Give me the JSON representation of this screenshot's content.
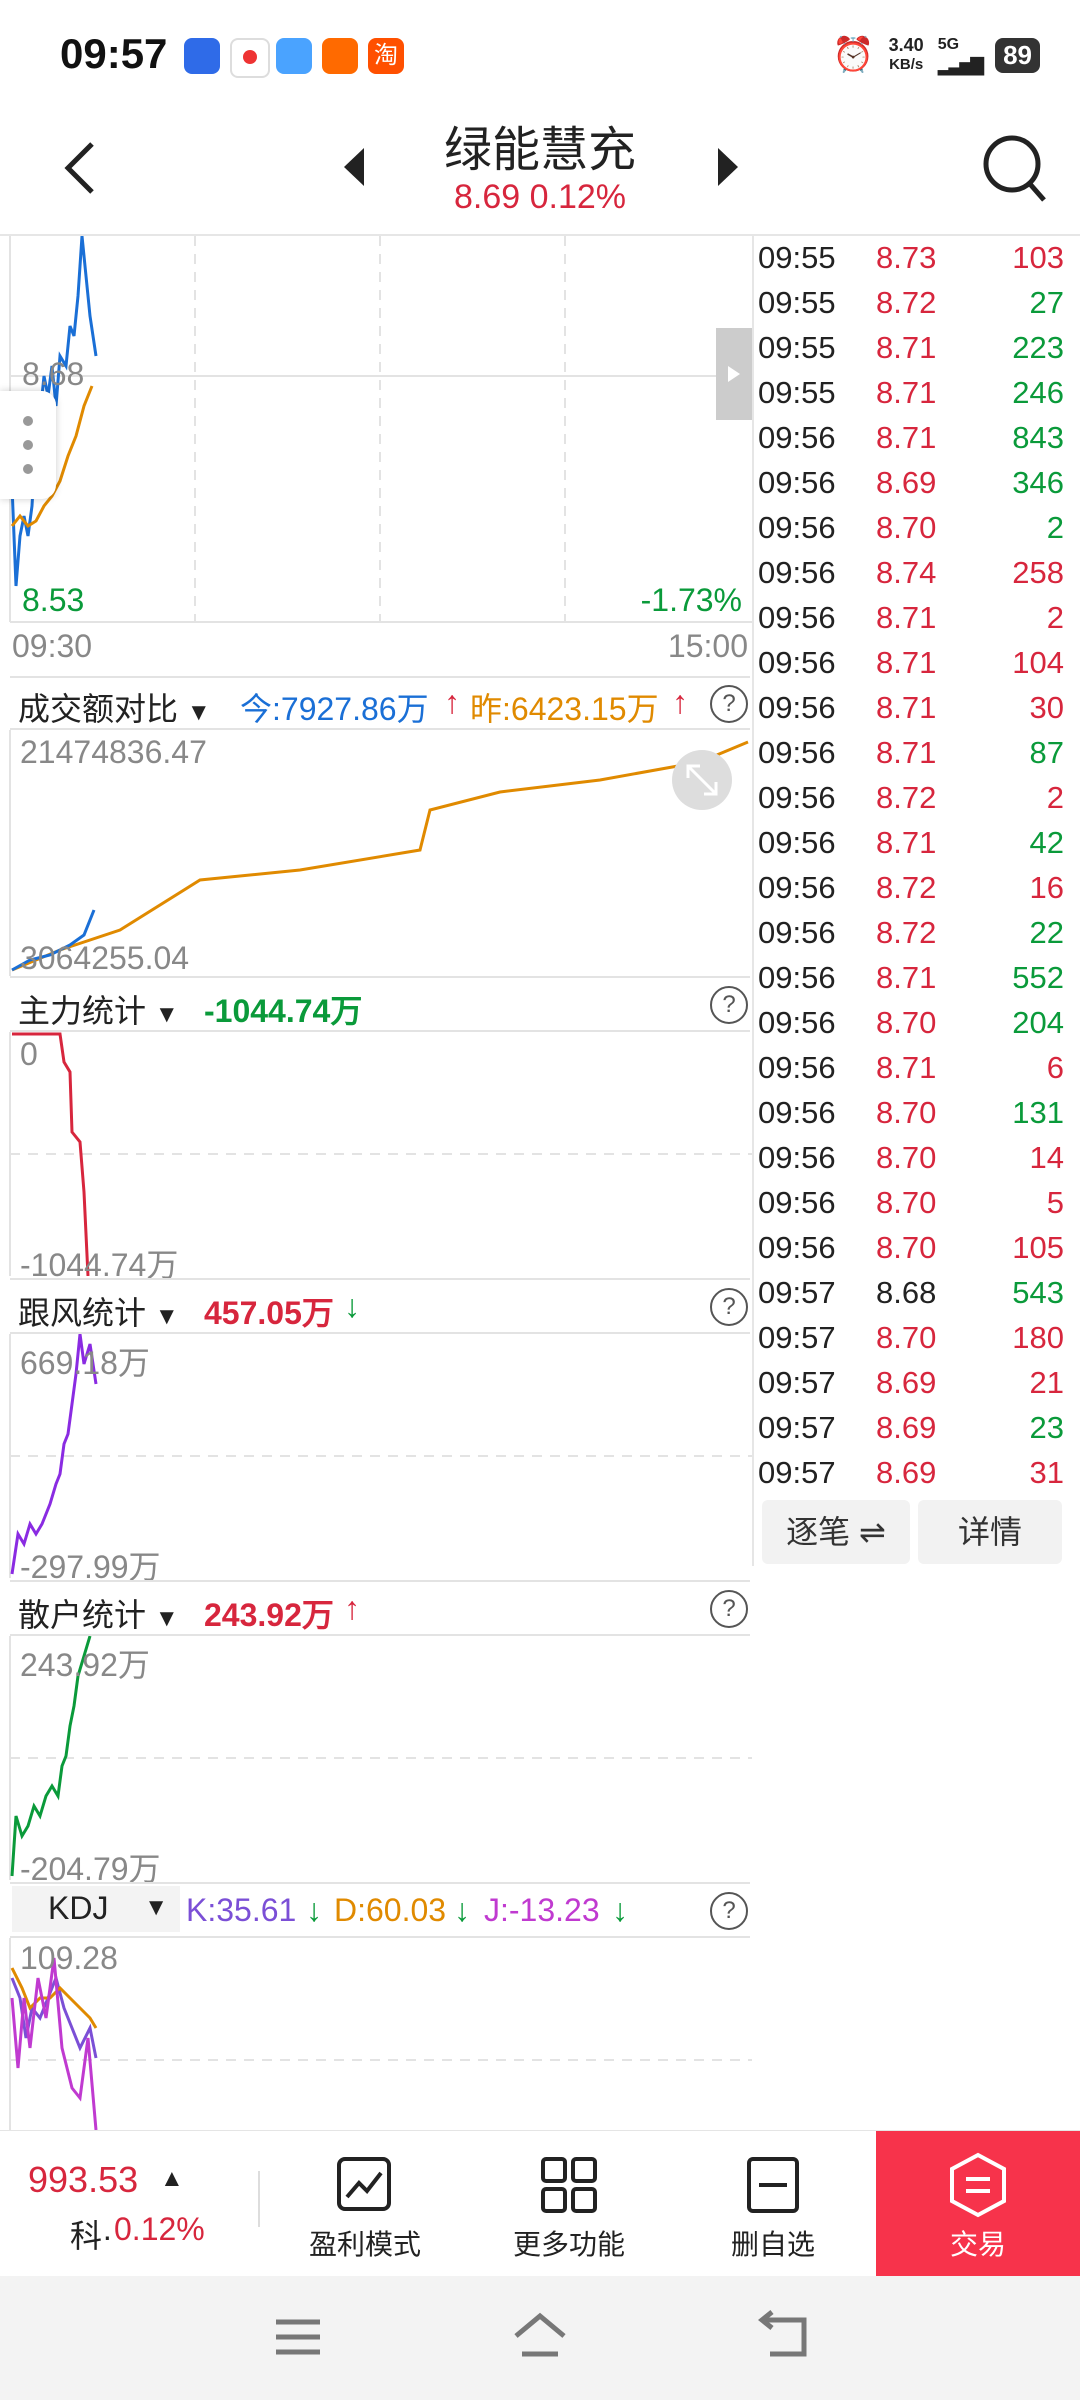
{
  "status_bar": {
    "time": "09:57",
    "net_speed": "3.40",
    "net_unit": "KB/s",
    "signal": "5G",
    "battery": "89"
  },
  "header": {
    "title": "绿能慧充",
    "price_change": "8.69 0.12%"
  },
  "price_chart": {
    "high_label": "8.68",
    "low_label": "8.53",
    "pct_label": "-1.73%",
    "start_time": "09:30",
    "end_time": "15:00"
  },
  "turnover": {
    "title": "成交额对比",
    "today": "今:7927.86万",
    "yesterday": "昨:6423.15万",
    "max_label": "21474836.47",
    "min_label": "3064255.04"
  },
  "main_force": {
    "title": "主力统计",
    "value": "-1044.74万",
    "max_label": "0",
    "min_label": "-1044.74万"
  },
  "follow": {
    "title": "跟风统计",
    "value": "457.05万",
    "max_label": "669.18万",
    "min_label": "-297.99万"
  },
  "retail": {
    "title": "散户统计",
    "value": "243.92万",
    "max_label": "243.92万",
    "min_label": "-204.79万"
  },
  "kdj": {
    "title": "KDJ",
    "k": "K:35.61",
    "d": "D:60.03",
    "j": "J:-13.23",
    "max_label": "109.28"
  },
  "ticks": [
    {
      "time": "09:55",
      "price": "8.73",
      "vol": "103",
      "pc": "red",
      "vc": "red"
    },
    {
      "time": "09:55",
      "price": "8.72",
      "vol": "27",
      "pc": "red",
      "vc": "green"
    },
    {
      "time": "09:55",
      "price": "8.71",
      "vol": "223",
      "pc": "red",
      "vc": "green"
    },
    {
      "time": "09:55",
      "price": "8.71",
      "vol": "246",
      "pc": "red",
      "vc": "green"
    },
    {
      "time": "09:56",
      "price": "8.71",
      "vol": "843",
      "pc": "red",
      "vc": "green"
    },
    {
      "time": "09:56",
      "price": "8.69",
      "vol": "346",
      "pc": "red",
      "vc": "green"
    },
    {
      "time": "09:56",
      "price": "8.70",
      "vol": "2",
      "pc": "red",
      "vc": "green"
    },
    {
      "time": "09:56",
      "price": "8.74",
      "vol": "258",
      "pc": "red",
      "vc": "red"
    },
    {
      "time": "09:56",
      "price": "8.71",
      "vol": "2",
      "pc": "red",
      "vc": "red"
    },
    {
      "time": "09:56",
      "price": "8.71",
      "vol": "104",
      "pc": "red",
      "vc": "red"
    },
    {
      "time": "09:56",
      "price": "8.71",
      "vol": "30",
      "pc": "red",
      "vc": "red"
    },
    {
      "time": "09:56",
      "price": "8.71",
      "vol": "87",
      "pc": "red",
      "vc": "green"
    },
    {
      "time": "09:56",
      "price": "8.72",
      "vol": "2",
      "pc": "red",
      "vc": "red"
    },
    {
      "time": "09:56",
      "price": "8.71",
      "vol": "42",
      "pc": "red",
      "vc": "green"
    },
    {
      "time": "09:56",
      "price": "8.72",
      "vol": "16",
      "pc": "red",
      "vc": "red"
    },
    {
      "time": "09:56",
      "price": "8.72",
      "vol": "22",
      "pc": "red",
      "vc": "green"
    },
    {
      "time": "09:56",
      "price": "8.71",
      "vol": "552",
      "pc": "red",
      "vc": "green"
    },
    {
      "time": "09:56",
      "price": "8.70",
      "vol": "204",
      "pc": "red",
      "vc": "green"
    },
    {
      "time": "09:56",
      "price": "8.71",
      "vol": "6",
      "pc": "red",
      "vc": "red"
    },
    {
      "time": "09:56",
      "price": "8.70",
      "vol": "131",
      "pc": "red",
      "vc": "green"
    },
    {
      "time": "09:56",
      "price": "8.70",
      "vol": "14",
      "pc": "red",
      "vc": "red"
    },
    {
      "time": "09:56",
      "price": "8.70",
      "vol": "5",
      "pc": "red",
      "vc": "red"
    },
    {
      "time": "09:56",
      "price": "8.70",
      "vol": "105",
      "pc": "red",
      "vc": "red"
    },
    {
      "time": "09:57",
      "price": "8.68",
      "vol": "543",
      "pc": "dark",
      "vc": "green"
    },
    {
      "time": "09:57",
      "price": "8.70",
      "vol": "180",
      "pc": "red",
      "vc": "red"
    },
    {
      "time": "09:57",
      "price": "8.69",
      "vol": "21",
      "pc": "red",
      "vc": "red"
    },
    {
      "time": "09:57",
      "price": "8.69",
      "vol": "23",
      "pc": "red",
      "vc": "green"
    },
    {
      "time": "09:57",
      "price": "8.69",
      "vol": "31",
      "pc": "red",
      "vc": "red"
    }
  ],
  "tick_buttons": {
    "detail_ticks": "逐笔 ⇌",
    "details": "详情"
  },
  "bottom_bar": {
    "index_value": "993.53",
    "index_name": "科·",
    "index_change": "0.12%",
    "profit_mode": "盈利模式",
    "more": "更多功能",
    "remove_watch": "删自选",
    "trade": "交易"
  },
  "colors": {
    "up": "#d7263d",
    "down": "#0a9a3a",
    "accent": "#f7334b"
  }
}
